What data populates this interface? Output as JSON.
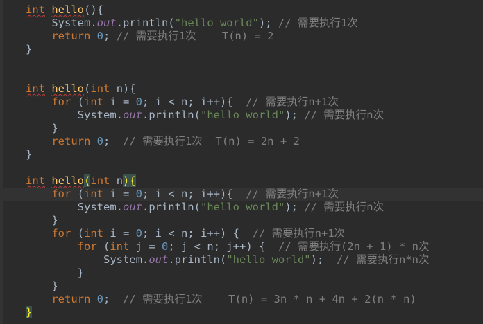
{
  "editor": {
    "colors": {
      "background": "#2b2b2b",
      "keyword": "#cc7832",
      "function": "#ffc66d",
      "number": "#6897bb",
      "string": "#6a8759",
      "comment": "#808080",
      "field": "#9876aa",
      "text": "#a9b7c6",
      "error_squiggle": "#bc3f3c",
      "brace_match": "#ffef28"
    },
    "current_line": 14,
    "lines": [
      [
        {
          "t": "kw",
          "v": "int"
        },
        {
          "t": "plain",
          "v": " "
        },
        {
          "t": "fn",
          "v": "hello"
        },
        {
          "t": "plain",
          "v": "(){"
        }
      ],
      [
        {
          "t": "plain",
          "v": "    System."
        },
        {
          "t": "field",
          "v": "out"
        },
        {
          "t": "plain",
          "v": ".println("
        },
        {
          "t": "str",
          "v": "\"hello world\""
        },
        {
          "t": "plain",
          "v": "); "
        },
        {
          "t": "cm",
          "v": "// 需要执行1次"
        }
      ],
      [
        {
          "t": "plain",
          "v": "    "
        },
        {
          "t": "kw",
          "v": "return"
        },
        {
          "t": "plain",
          "v": " "
        },
        {
          "t": "num",
          "v": "0"
        },
        {
          "t": "plain",
          "v": "; "
        },
        {
          "t": "cm",
          "v": "// 需要执行1次    T(n) = 2"
        }
      ],
      [
        {
          "t": "plain",
          "v": "}"
        }
      ],
      [],
      [],
      [
        {
          "t": "kw",
          "v": "int"
        },
        {
          "t": "plain",
          "v": " "
        },
        {
          "t": "fn",
          "v": "hello"
        },
        {
          "t": "plain",
          "v": "("
        },
        {
          "t": "kw",
          "v": "int"
        },
        {
          "t": "plain",
          "v": " n){"
        }
      ],
      [
        {
          "t": "plain",
          "v": "    "
        },
        {
          "t": "kw",
          "v": "for"
        },
        {
          "t": "plain",
          "v": " ("
        },
        {
          "t": "kw",
          "v": "int"
        },
        {
          "t": "plain",
          "v": " i = "
        },
        {
          "t": "num",
          "v": "0"
        },
        {
          "t": "plain",
          "v": "; i < n; i++){  "
        },
        {
          "t": "cm",
          "v": "// 需要执行n+1次"
        }
      ],
      [
        {
          "t": "plain",
          "v": "        System."
        },
        {
          "t": "field",
          "v": "out"
        },
        {
          "t": "plain",
          "v": ".println("
        },
        {
          "t": "str",
          "v": "\"hello world\""
        },
        {
          "t": "plain",
          "v": "); "
        },
        {
          "t": "cm",
          "v": "// 需要执行n次"
        }
      ],
      [
        {
          "t": "plain",
          "v": "    }"
        }
      ],
      [
        {
          "t": "plain",
          "v": "    "
        },
        {
          "t": "kw",
          "v": "return"
        },
        {
          "t": "plain",
          "v": " "
        },
        {
          "t": "num",
          "v": "0"
        },
        {
          "t": "plain",
          "v": ";  "
        },
        {
          "t": "cm",
          "v": "// 需要执行1次  T(n) = 2n + 2"
        }
      ],
      [
        {
          "t": "plain",
          "v": "}"
        }
      ],
      [],
      [
        {
          "t": "kw",
          "v": "int"
        },
        {
          "t": "plain",
          "v": " "
        },
        {
          "t": "fn",
          "v": "hello"
        },
        {
          "t": "brace",
          "v": "("
        },
        {
          "t": "kw",
          "v": "int"
        },
        {
          "t": "plain",
          "v": " n"
        },
        {
          "t": "brace",
          "v": "){"
        }
      ],
      [
        {
          "t": "plain",
          "v": "    "
        },
        {
          "t": "kw",
          "v": "for"
        },
        {
          "t": "plain",
          "v": " ("
        },
        {
          "t": "kw",
          "v": "int"
        },
        {
          "t": "plain",
          "v": " i = "
        },
        {
          "t": "num",
          "v": "0"
        },
        {
          "t": "plain",
          "v": "; i < n; i++){  "
        },
        {
          "t": "cm",
          "v": "// 需要执行n+1次"
        }
      ],
      [
        {
          "t": "plain",
          "v": "        System."
        },
        {
          "t": "field",
          "v": "out"
        },
        {
          "t": "plain",
          "v": ".println("
        },
        {
          "t": "str",
          "v": "\"hello world\""
        },
        {
          "t": "plain",
          "v": "); "
        },
        {
          "t": "cm",
          "v": "// 需要执行n次"
        }
      ],
      [
        {
          "t": "plain",
          "v": "    }"
        }
      ],
      [
        {
          "t": "plain",
          "v": "    "
        },
        {
          "t": "kw",
          "v": "for"
        },
        {
          "t": "plain",
          "v": " ("
        },
        {
          "t": "kw",
          "v": "int"
        },
        {
          "t": "plain",
          "v": " i = "
        },
        {
          "t": "num",
          "v": "0"
        },
        {
          "t": "plain",
          "v": "; i < n; i++) {  "
        },
        {
          "t": "cm",
          "v": "// 需要执行n+1次"
        }
      ],
      [
        {
          "t": "plain",
          "v": "        "
        },
        {
          "t": "kw",
          "v": "for"
        },
        {
          "t": "plain",
          "v": " ("
        },
        {
          "t": "kw",
          "v": "int"
        },
        {
          "t": "plain",
          "v": " j = "
        },
        {
          "t": "num",
          "v": "0"
        },
        {
          "t": "plain",
          "v": "; j < n; j++) {  "
        },
        {
          "t": "cm",
          "v": "// 需要执行(2n + 1) * n次"
        }
      ],
      [
        {
          "t": "plain",
          "v": "            System."
        },
        {
          "t": "field",
          "v": "out"
        },
        {
          "t": "plain",
          "v": ".println("
        },
        {
          "t": "str",
          "v": "\"hello world\""
        },
        {
          "t": "plain",
          "v": ");  "
        },
        {
          "t": "cm",
          "v": "// 需要执行n*n次"
        }
      ],
      [
        {
          "t": "plain",
          "v": "        }"
        }
      ],
      [
        {
          "t": "plain",
          "v": "    }"
        }
      ],
      [
        {
          "t": "plain",
          "v": "    "
        },
        {
          "t": "kw",
          "v": "return"
        },
        {
          "t": "plain",
          "v": " "
        },
        {
          "t": "num",
          "v": "0"
        },
        {
          "t": "plain",
          "v": ";  "
        },
        {
          "t": "cm",
          "v": "// 需要执行1次    T(n) = 3n * n + 4n + 2(n * n)"
        }
      ],
      [
        {
          "t": "brace",
          "v": "}"
        }
      ]
    ]
  }
}
